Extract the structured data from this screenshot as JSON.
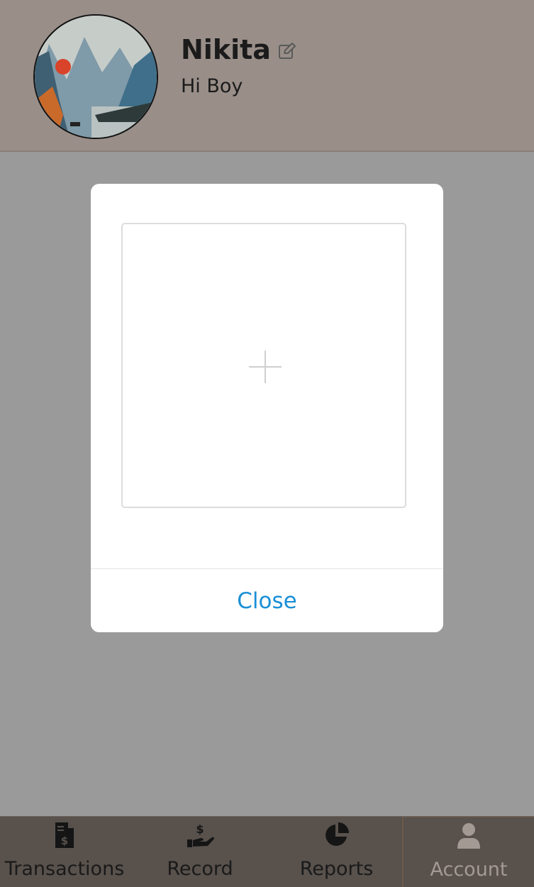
{
  "profile": {
    "name": "Nikita",
    "status": "Hi Boy",
    "avatar_icon": "landscape-painting-avatar",
    "edit_icon": "edit-icon"
  },
  "modal": {
    "upload_icon": "plus-icon",
    "close_label": "Close"
  },
  "nav": {
    "items": [
      {
        "label": "Transactions",
        "icon": "document-dollar-icon"
      },
      {
        "label": "Record",
        "icon": "hand-dollar-icon"
      },
      {
        "label": "Reports",
        "icon": "pie-chart-icon"
      },
      {
        "label": "Account",
        "icon": "user-icon"
      }
    ],
    "active": "Account"
  },
  "colors": {
    "accent": "#1a8fd6",
    "overlay": "#9a9a9a",
    "header": "#998e88",
    "nav_bg": "#58514c"
  }
}
